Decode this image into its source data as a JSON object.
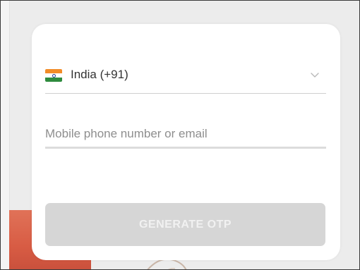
{
  "country_select": {
    "flag_icon": "india-flag-icon",
    "label": "India (+91)",
    "chevron_icon": "chevron-down-icon"
  },
  "phone_input": {
    "placeholder": "Mobile phone number or email",
    "value": ""
  },
  "generate_button": {
    "label": "GENERATE OTP",
    "state": "disabled"
  },
  "colors": {
    "card_background": "#ffffff",
    "page_background": "#ececec",
    "button_disabled": "#d6d6d6",
    "button_text": "#f1f1f1",
    "flag_saffron": "#f28c28",
    "flag_green": "#2e8b3e",
    "photo_accent": "#e07258"
  }
}
